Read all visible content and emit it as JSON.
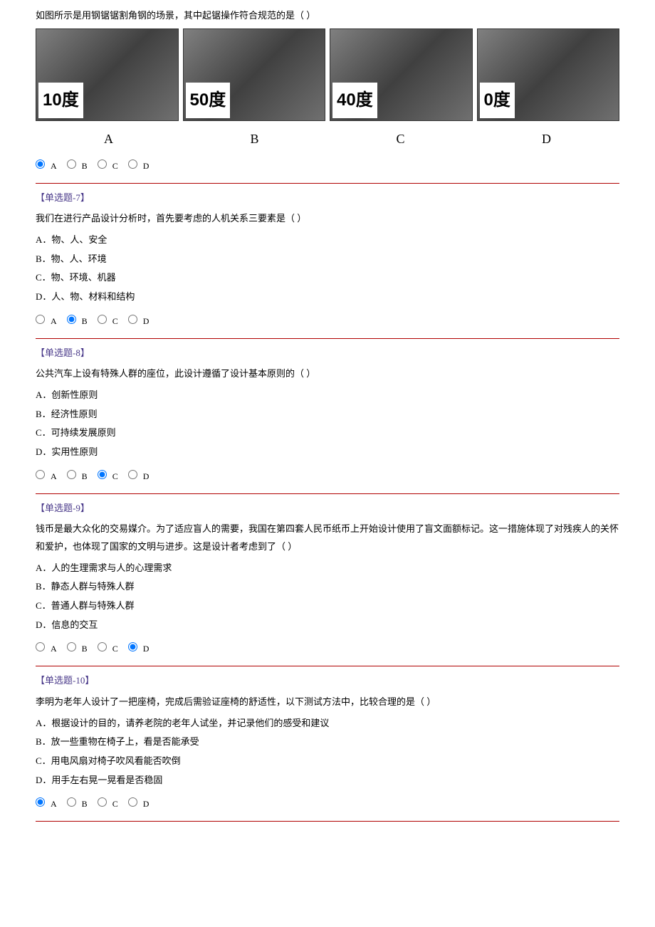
{
  "q6": {
    "text": "如图所示是用钢锯锯割角钢的场景，其中起锯操作符合规范的是（ ）",
    "images": {
      "angles": [
        "10度",
        "50度",
        "40度",
        "0度"
      ],
      "labels": [
        "A",
        "B",
        "C",
        "D"
      ]
    },
    "radios": [
      "A",
      "B",
      "C",
      "D"
    ],
    "selected": 0
  },
  "q7": {
    "title": "【单选题-7】",
    "text": "我们在进行产品设计分析时，首先要考虑的人机关系三要素是（ ）",
    "options": [
      "A．物、人、安全",
      "B．物、人、环境",
      "C．物、环境、机器",
      "D．人、物、材料和结构"
    ],
    "radios": [
      "A",
      "B",
      "C",
      "D"
    ],
    "selected": 1
  },
  "q8": {
    "title": "【单选题-8】",
    "text": "公共汽车上设有特殊人群的座位，此设计遵循了设计基本原则的（ ）",
    "options": [
      "A．创新性原则",
      "B．经济性原则",
      "C．可持续发展原则",
      "D．实用性原则"
    ],
    "radios": [
      "A",
      "B",
      "C",
      "D"
    ],
    "selected": 2
  },
  "q9": {
    "title": "【单选题-9】",
    "text": "钱币是最大众化的交易媒介。为了适应盲人的需要，我国在第四套人民币纸币上开始设计使用了盲文面额标记。这一措施体现了对残疾人的关怀和爱护，也体现了国家的文明与进步。这是设计者考虑到了（ ）",
    "options": [
      "A．人的生理需求与人的心理需求",
      "B．静态人群与特殊人群",
      "C．普通人群与特殊人群",
      "D．信息的交互"
    ],
    "radios": [
      "A",
      "B",
      "C",
      "D"
    ],
    "selected": 3
  },
  "q10": {
    "title": "【单选题-10】",
    "text": "李明为老年人设计了一把座椅，完成后需验证座椅的舒适性，以下测试方法中，比较合理的是（ ）",
    "options": [
      "A．根据设计的目的，请养老院的老年人试坐，并记录他们的感受和建议",
      "B．放一些重物在椅子上，看是否能承受",
      "C．用电风扇对椅子吹风看能否吹倒",
      "D．用手左右晃一晃看是否稳固"
    ],
    "radios": [
      "A",
      "B",
      "C",
      "D"
    ],
    "selected": 0
  }
}
